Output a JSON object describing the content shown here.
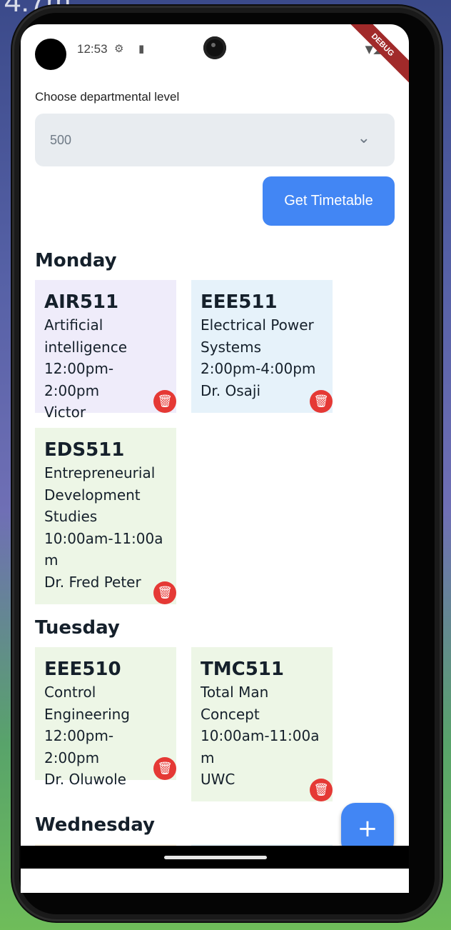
{
  "status_bar": {
    "time": "12:53",
    "settings_icon": "⚙",
    "sd_icon": "▮",
    "signal_icons": "▼◢▮",
    "debug_banner": "DEBUG"
  },
  "background_text": "4:7m",
  "form": {
    "label": "Choose departmental level",
    "select_value": "500",
    "button_label": "Get Timetable"
  },
  "schedule": [
    {
      "day": "Monday",
      "courses": [
        {
          "code": "AIR511",
          "lines": [
            "Artificial",
            "intelligence",
            "12:00pm-2:00pm",
            "Victor"
          ],
          "color": "#efecfa"
        },
        {
          "code": "EEE511",
          "lines": [
            "Electrical Power",
            "Systems",
            "2:00pm-4:00pm",
            "Dr. Osaji"
          ],
          "color": "#e6f2fa"
        },
        {
          "code": "EDS511",
          "lines": [
            "Entrepreneurial",
            "Development",
            "Studies",
            "10:00am-11:00a",
            "m",
            "Dr. Fred Peter"
          ],
          "color": "#edf6e6"
        }
      ]
    },
    {
      "day": "Tuesday",
      "courses": [
        {
          "code": "EEE510",
          "lines": [
            "Control",
            "Engineering",
            "12:00pm-2:00pm",
            "Dr. Oluwole"
          ],
          "color": "#edf6e6"
        },
        {
          "code": "TMC511",
          "lines": [
            "Total Man",
            "Concept",
            "10:00am-11:00a",
            "m",
            "UWC"
          ],
          "color": "#edf6e6"
        }
      ]
    },
    {
      "day": "Wednesday",
      "courses": []
    }
  ],
  "icons": {
    "trash": "🗑",
    "chevron": "⌄",
    "fab": "+"
  },
  "colors": {
    "accent": "#4286f4",
    "delete": "#e53935"
  }
}
